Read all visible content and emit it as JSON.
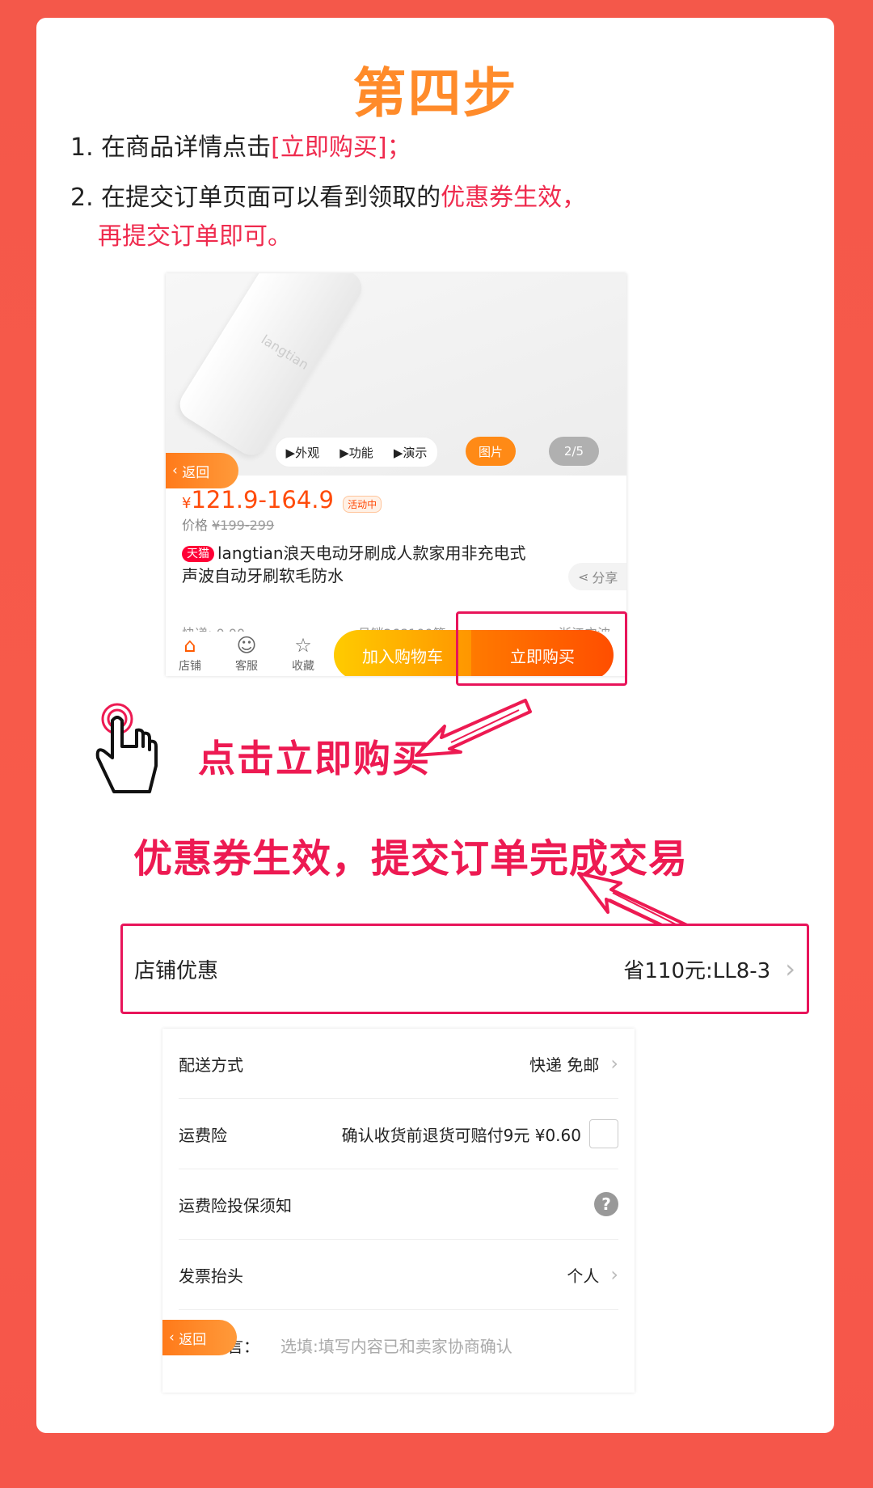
{
  "step_title": "第四步",
  "instructions": {
    "line1_prefix": "1. 在商品详情点击",
    "line1_highlight": "[立即购买]；",
    "line2_prefix": "2. 在提交订单页面可以看到领取的",
    "line2_highlight": "优惠券生效，",
    "line3_highlight": "再提交订单即可。"
  },
  "product_page": {
    "brand_logo": "langtian",
    "media_tabs": [
      "▶外观",
      "▶功能",
      "▶演示"
    ],
    "picture_tab": "图片",
    "image_counter": "2/5",
    "back_label": "返回",
    "price": "121.9-164.9",
    "currency": "¥",
    "activity_tag": "活动中",
    "original_price_label": "价格",
    "original_price": "¥199-299",
    "tmall_badge": "天猫",
    "title": "langtian浪天电动牙刷成人款家用非充电式声波自动牙刷软毛防水",
    "share_label": "分享",
    "shipping": "快递: 0.00",
    "monthly_sales": "月销268100笔",
    "location": "浙江宁波",
    "bottom_bar": {
      "store": "店铺",
      "service": "客服",
      "favorite": "收藏",
      "add_to_cart": "加入购物车",
      "buy_now": "立即购买"
    }
  },
  "callouts": {
    "click_buy": "点击立即购买",
    "coupon_effective": "优惠券生效，提交订单完成交易"
  },
  "order_page": {
    "store_discount_label": "店铺优惠",
    "store_discount_value": "省110元:LL8-3",
    "rows": [
      {
        "label": "配送方式",
        "value": "快递 免邮"
      },
      {
        "label": "运费险",
        "value": "确认收货前退货可赔付9元  ¥0.60"
      },
      {
        "label": "运费险投保须知",
        "value": ""
      },
      {
        "label": "发票抬头",
        "value": "个人"
      },
      {
        "label": "买家留言：",
        "value": "选填:填写内容已和卖家协商确认"
      }
    ],
    "back_label": "返回"
  },
  "colors": {
    "accent_red": "#ed1a52",
    "title_orange": "#ff8b2a",
    "buy_orange": "#ff5a00",
    "background": "#f5584a"
  }
}
